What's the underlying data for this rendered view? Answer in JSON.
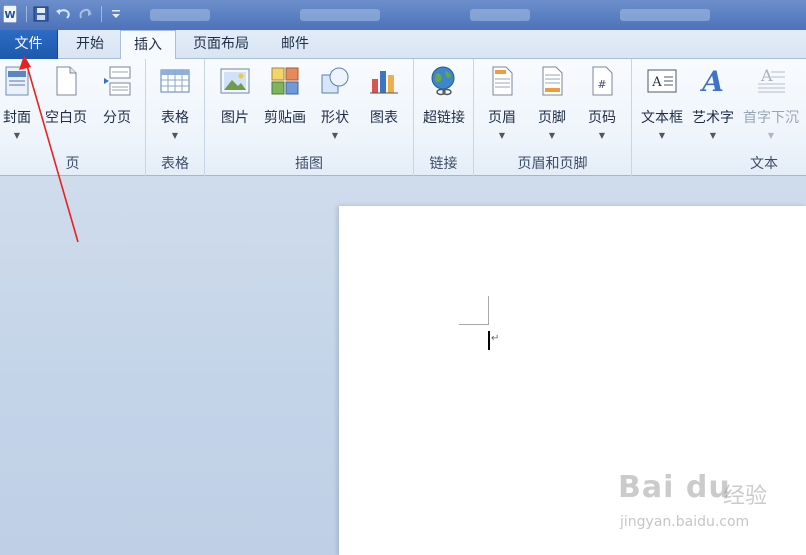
{
  "quick_access": {
    "icons": [
      "word-app-icon",
      "save-icon",
      "undo-icon",
      "redo-icon",
      "customize-icon"
    ]
  },
  "tabs": [
    {
      "label": "文件",
      "state": "file"
    },
    {
      "label": "开始",
      "state": "normal"
    },
    {
      "label": "插入",
      "state": "active"
    },
    {
      "label": "页面布局",
      "state": "normal"
    },
    {
      "label": "邮件",
      "state": "normal"
    }
  ],
  "ribbon": {
    "groups": [
      {
        "label": "页",
        "buttons": [
          {
            "label": "封面",
            "icon": "cover-page-icon",
            "dropdown": true
          },
          {
            "label": "空白页",
            "icon": "blank-page-icon",
            "dropdown": false
          },
          {
            "label": "分页",
            "icon": "page-break-icon",
            "dropdown": false
          }
        ]
      },
      {
        "label": "表格",
        "buttons": [
          {
            "label": "表格",
            "icon": "table-icon",
            "dropdown": true
          }
        ]
      },
      {
        "label": "插图",
        "buttons": [
          {
            "label": "图片",
            "icon": "picture-icon",
            "dropdown": false
          },
          {
            "label": "剪贴画",
            "icon": "clipart-icon",
            "dropdown": false
          },
          {
            "label": "形状",
            "icon": "shapes-icon",
            "dropdown": true
          },
          {
            "label": "图表",
            "icon": "chart-icon",
            "dropdown": false
          }
        ]
      },
      {
        "label": "链接",
        "buttons": [
          {
            "label": "超链接",
            "icon": "hyperlink-icon",
            "dropdown": false
          }
        ]
      },
      {
        "label": "页眉和页脚",
        "buttons": [
          {
            "label": "页眉",
            "icon": "header-icon",
            "dropdown": true
          },
          {
            "label": "页脚",
            "icon": "footer-icon",
            "dropdown": true
          },
          {
            "label": "页码",
            "icon": "page-number-icon",
            "dropdown": true
          }
        ]
      },
      {
        "label": "文本",
        "buttons": [
          {
            "label": "文本框",
            "icon": "textbox-icon",
            "dropdown": true
          },
          {
            "label": "艺术字",
            "icon": "wordart-icon",
            "dropdown": true
          },
          {
            "label": "首字下沉",
            "icon": "drop-cap-icon",
            "dropdown": true,
            "disabled": true
          }
        ]
      }
    ]
  },
  "document": {
    "paragraph_mark": "↵"
  },
  "watermark": {
    "logo": "Bai du",
    "cn": "经验",
    "url": "jingyan.baidu.com"
  },
  "colors": {
    "file_tab": "#1d58ae",
    "annotation_arrow": "#e8231f",
    "title_bar": "#5a7fc2"
  }
}
